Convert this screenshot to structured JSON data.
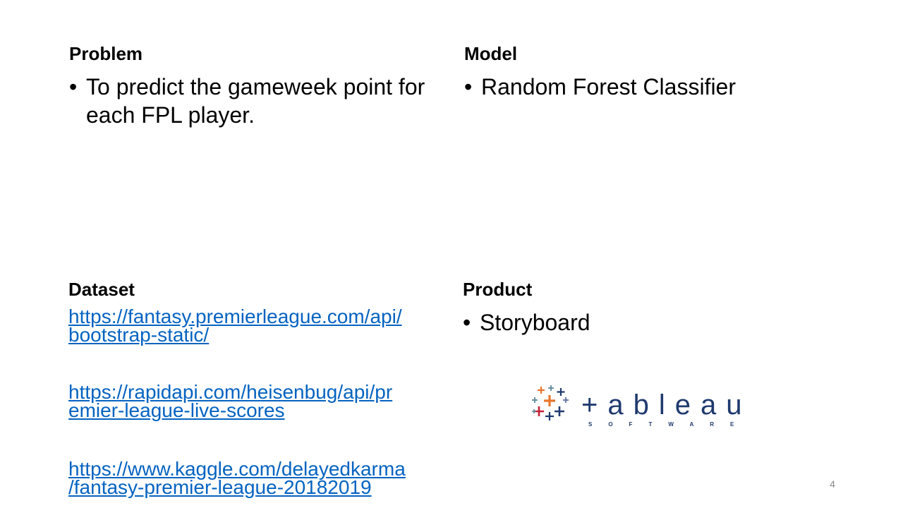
{
  "problem": {
    "heading": "Problem",
    "bullet": "To predict the gameweek point for each FPL player."
  },
  "model": {
    "heading": "Model",
    "bullet": "Random Forest Classifier"
  },
  "dataset": {
    "heading": "Dataset",
    "links": [
      {
        "line1": "https://fantasy.premierleague.com/api/",
        "line2": "bootstrap-static/"
      },
      {
        "line1": "https://rapidapi.com/heisenbug/api/pr",
        "line2": "emier-league-live-scores"
      },
      {
        "line1": "https://www.kaggle.com/delayedkarma",
        "line2": "/fantasy-premier-league-20182019"
      }
    ]
  },
  "product": {
    "heading": "Product",
    "bullet": "Storyboard",
    "logo": {
      "word": "+ableau",
      "subtext": "SOFTWARE"
    }
  },
  "page_number": "4",
  "colors": {
    "link": "#0563c1",
    "logo_navy": "#1f3a6e",
    "logo_orange": "#e8762b",
    "logo_red": "#c72035",
    "logo_blue": "#5b6fa6",
    "logo_teal": "#59879b"
  }
}
